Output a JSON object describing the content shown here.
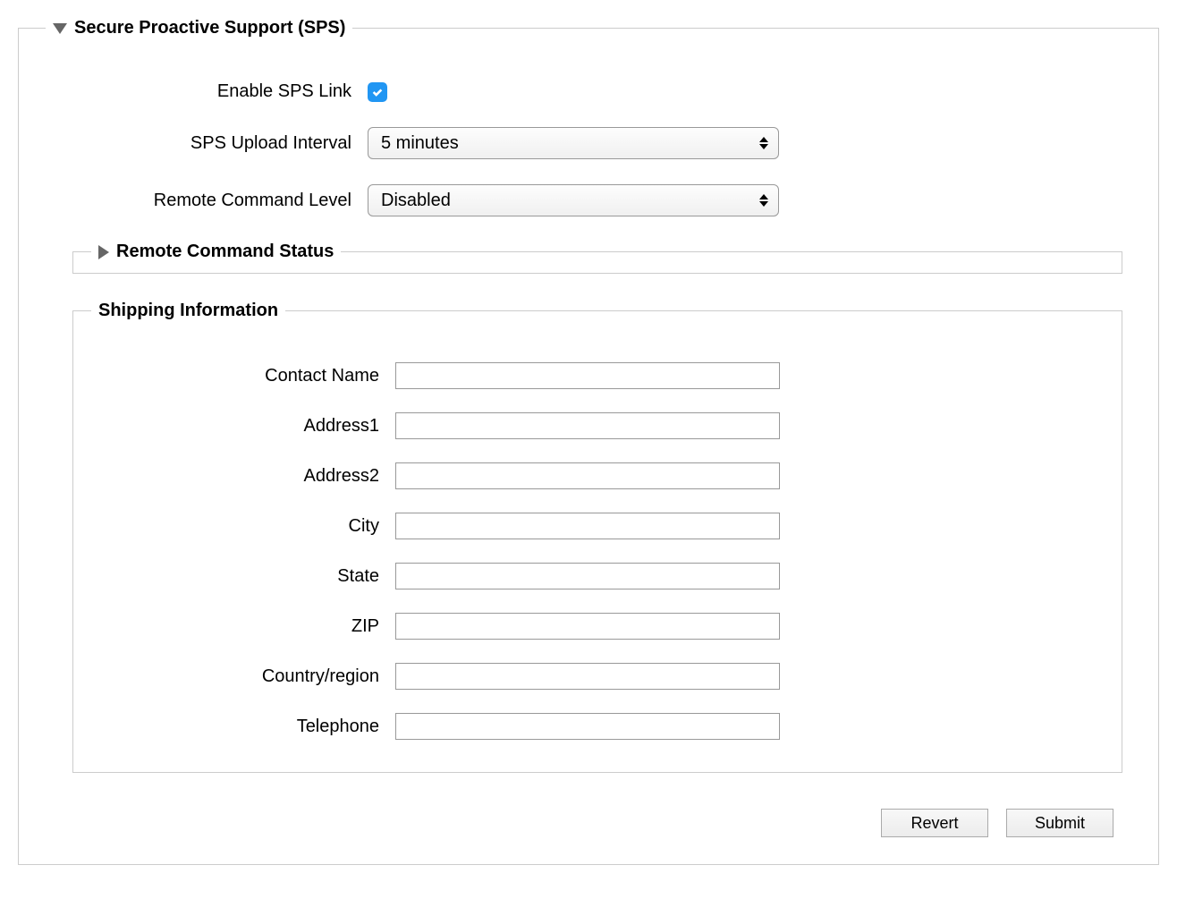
{
  "sps": {
    "title": "Secure Proactive Support (SPS)",
    "enable_label": "Enable SPS Link",
    "enable_checked": true,
    "upload_interval_label": "SPS Upload Interval",
    "upload_interval_value": "5 minutes",
    "remote_command_level_label": "Remote Command Level",
    "remote_command_level_value": "Disabled",
    "remote_command_status_title": "Remote Command Status"
  },
  "shipping": {
    "title": "Shipping Information",
    "contact_name_label": "Contact Name",
    "contact_name_value": "",
    "address1_label": "Address1",
    "address1_value": "",
    "address2_label": "Address2",
    "address2_value": "",
    "city_label": "City",
    "city_value": "",
    "state_label": "State",
    "state_value": "",
    "zip_label": "ZIP",
    "zip_value": "",
    "country_label": "Country/region",
    "country_value": "",
    "telephone_label": "Telephone",
    "telephone_value": ""
  },
  "buttons": {
    "revert": "Revert",
    "submit": "Submit"
  }
}
